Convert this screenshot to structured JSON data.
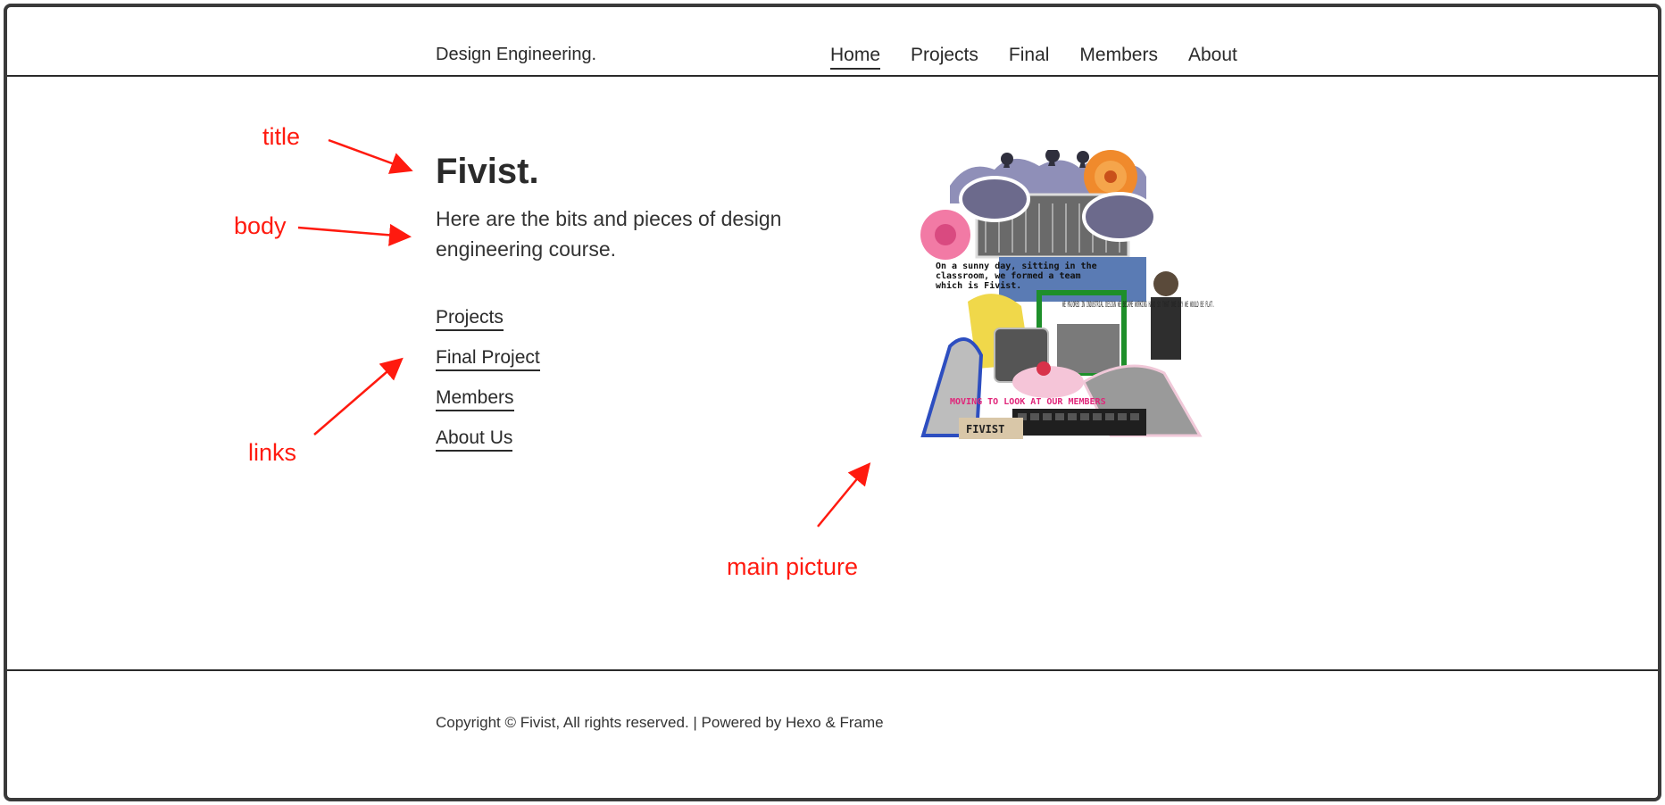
{
  "header": {
    "brand": "Design Engineering.",
    "nav": [
      {
        "label": "Home",
        "active": true
      },
      {
        "label": "Projects",
        "active": false
      },
      {
        "label": "Final",
        "active": false
      },
      {
        "label": "Members",
        "active": false
      },
      {
        "label": "About",
        "active": false
      }
    ]
  },
  "hero": {
    "title": "Fivist.",
    "body": "Here are the bits and pieces of design engineering course.",
    "links": [
      "Projects",
      "Final Project",
      "Members",
      "About Us"
    ]
  },
  "collage": {
    "caption_line1": "On a sunny day, sitting in the",
    "caption_line2": "classroom, we formed a team",
    "caption_line3": "which is Fivist.",
    "side_text": "WE MAJORED IN INDUSTRIAL DESIGN WE BECAME WORKING HARD SO THAT ONE DAY WE WOULD BE FLAT.",
    "bottom_text": "MOVING TO LOOK AT OUR MEMBERS",
    "tag": "FIVIST"
  },
  "footer": {
    "text": "Copyright © Fivist, All rights reserved. | Powered by Hexo & Frame"
  },
  "annotations": {
    "title": "title",
    "body": "body",
    "links": "links",
    "main_picture": "main picture"
  },
  "colors": {
    "annotation": "#ff1a0f",
    "text": "#2a2a2a",
    "frame": "#3a3a3a"
  }
}
